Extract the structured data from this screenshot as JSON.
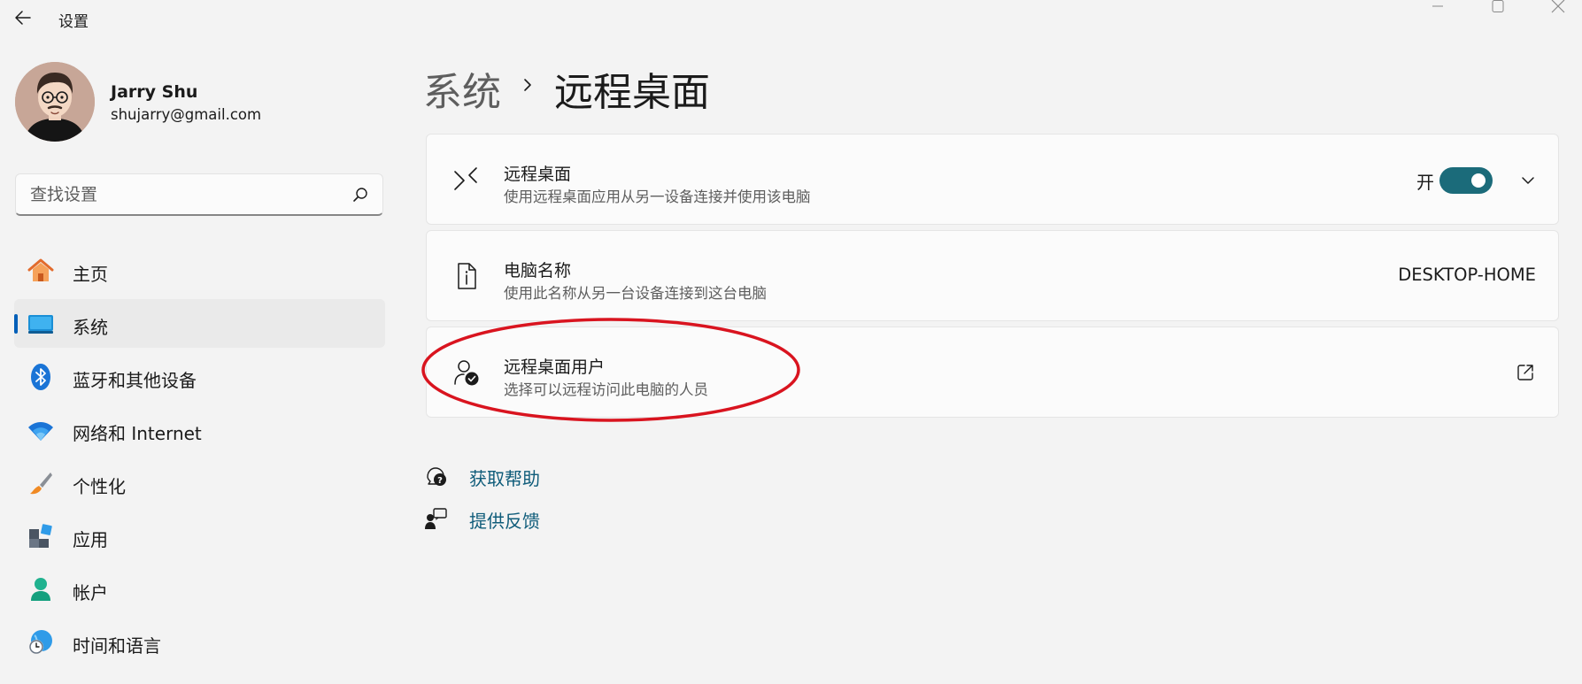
{
  "window": {
    "app_title": "设置"
  },
  "user": {
    "name": "Jarry Shu",
    "email": "shujarry@gmail.com"
  },
  "search": {
    "placeholder": "查找设置"
  },
  "nav": {
    "items": [
      {
        "label": "主页",
        "icon": "home-icon",
        "selected": false
      },
      {
        "label": "系统",
        "icon": "system-display-icon",
        "selected": true
      },
      {
        "label": "蓝牙和其他设备",
        "icon": "bluetooth-icon",
        "selected": false
      },
      {
        "label": "网络和 Internet",
        "icon": "wifi-icon",
        "selected": false
      },
      {
        "label": "个性化",
        "icon": "paintbrush-icon",
        "selected": false
      },
      {
        "label": "应用",
        "icon": "apps-icon",
        "selected": false
      },
      {
        "label": "帐户",
        "icon": "account-icon",
        "selected": false
      },
      {
        "label": "时间和语言",
        "icon": "globe-clock-icon",
        "selected": false
      }
    ]
  },
  "breadcrumb": {
    "parent": "系统",
    "current": "远程桌面"
  },
  "cards": {
    "remote_desktop": {
      "title": "远程桌面",
      "subtitle": "使用远程桌面应用从另一设备连接并使用该电脑",
      "toggle_state_label": "开",
      "toggle_on": true
    },
    "pc_name": {
      "title": "电脑名称",
      "subtitle": "使用此名称从另一台设备连接到这台电脑",
      "value": "DESKTOP-HOME"
    },
    "remote_users": {
      "title": "远程桌面用户",
      "subtitle": "选择可以远程访问此电脑的人员"
    }
  },
  "links": {
    "get_help": "获取帮助",
    "give_feedback": "提供反馈"
  },
  "colors": {
    "accent": "#005fb8",
    "toggle_on": "#1b6b7a",
    "link": "#0f5c7a",
    "annotation": "#d9141f"
  }
}
